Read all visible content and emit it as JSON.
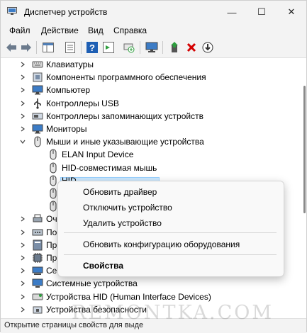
{
  "window": {
    "title": "Диспетчер устройств",
    "minimize": "—",
    "maximize": "☐",
    "close": "✕"
  },
  "menu": [
    "Файл",
    "Действие",
    "Вид",
    "Справка"
  ],
  "tree": [
    {
      "label": "Клавиатуры",
      "icon": "keyboard-icon",
      "state": "collapsed"
    },
    {
      "label": "Компоненты программного обеспечения",
      "icon": "software-component-icon",
      "state": "collapsed"
    },
    {
      "label": "Компьютер",
      "icon": "computer-icon",
      "state": "collapsed"
    },
    {
      "label": "Контроллеры USB",
      "icon": "usb-icon",
      "state": "collapsed"
    },
    {
      "label": "Контроллеры запоминающих устройств",
      "icon": "storage-controller-icon",
      "state": "collapsed"
    },
    {
      "label": "Мониторы",
      "icon": "monitor-icon",
      "state": "collapsed"
    },
    {
      "label": "Мыши и иные указывающие устройства",
      "icon": "mouse-icon",
      "state": "expanded"
    },
    {
      "label": "ELAN Input Device",
      "icon": "mouse-icon",
      "state": "child"
    },
    {
      "label": "HID-совместимая мышь",
      "icon": "mouse-icon",
      "state": "child"
    },
    {
      "label": "HID-",
      "icon": "mouse-icon",
      "state": "child-selected"
    },
    {
      "label": "",
      "icon": "mouse-icon",
      "state": "child"
    },
    {
      "label": "",
      "icon": "mouse-icon",
      "state": "child"
    },
    {
      "label": "Оч",
      "icon": "print-queue-icon",
      "state": "collapsed"
    },
    {
      "label": "По",
      "icon": "port-icon",
      "state": "collapsed"
    },
    {
      "label": "Пр",
      "icon": "software-device-icon",
      "state": "collapsed"
    },
    {
      "label": "Пр",
      "icon": "processor-icon",
      "state": "collapsed"
    },
    {
      "label": "Се",
      "icon": "network-adapter-icon",
      "state": "collapsed"
    },
    {
      "label": "Системные устройства",
      "icon": "system-device-icon",
      "state": "collapsed"
    },
    {
      "label": "Устройства HID (Human Interface Devices)",
      "icon": "hid-icon",
      "state": "collapsed"
    },
    {
      "label": "Устройства безопасности",
      "icon": "security-device-icon",
      "state": "collapsed"
    }
  ],
  "context_menu": {
    "update_driver": "Обновить драйвер",
    "disable_device": "Отключить устройство",
    "uninstall_device": "Удалить устройство",
    "scan_hardware": "Обновить конфигурацию оборудования",
    "properties": "Свойства"
  },
  "status": "Открытие страницы свойств для выде",
  "watermark": "REMONTKA.COM",
  "colors": {
    "selection": "#cce8ff",
    "delete_red": "#d40000",
    "green": "#2e9e3e",
    "blue_help": "#1e5fb4"
  }
}
